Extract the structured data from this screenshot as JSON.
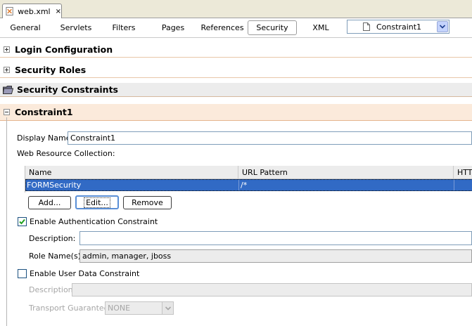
{
  "editor": {
    "file_tab": {
      "label": "web.xml",
      "close": "×"
    }
  },
  "nav": {
    "tabs": [
      "General",
      "Servlets",
      "Filters",
      "Pages",
      "References",
      "Security",
      "XML"
    ],
    "active_tab": "Security",
    "combo_value": "Constraint1"
  },
  "sections": {
    "login": "Login Configuration",
    "roles": "Security Roles",
    "constraints": "Security Constraints",
    "constraint1": "Constraint1"
  },
  "form": {
    "display_name_label": "Display Name:",
    "display_name_value": "Constraint1",
    "wrc_label": "Web Resource Collection:",
    "table": {
      "columns": [
        "Name",
        "URL Pattern",
        "HTTP"
      ],
      "rows": [
        {
          "name": "FORMSecurity",
          "url_pattern": "/*",
          "http": ""
        }
      ]
    },
    "buttons": {
      "add": "Add...",
      "edit": "Edit...",
      "remove": "Remove"
    },
    "auth": {
      "checkbox_label": "Enable Authentication Constraint",
      "checked": true,
      "description_label": "Description:",
      "description_value": "",
      "roles_label": "Role Name(s):",
      "roles_value": "admin, manager, jboss"
    },
    "user_data": {
      "checkbox_label": "Enable User Data Constraint",
      "checked": false,
      "description_label": "Description:",
      "description_value": "",
      "transport_label": "Transport Guarantee:",
      "transport_value": "NONE"
    }
  },
  "colors": {
    "selection": "#316ac5",
    "section_header": "#fbeadb",
    "accent_border": "#e4b58e"
  }
}
